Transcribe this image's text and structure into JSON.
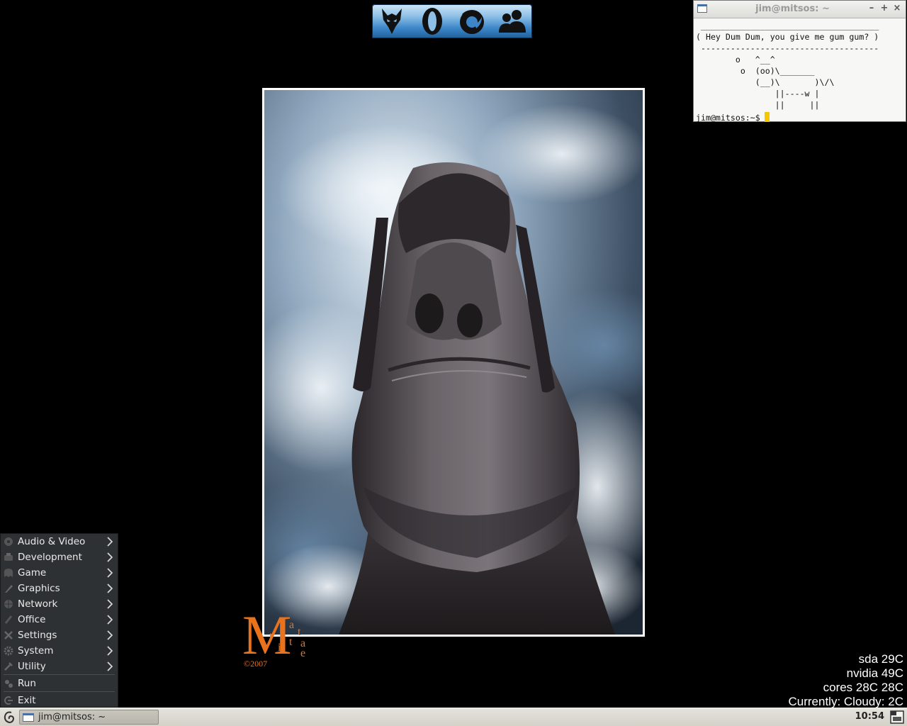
{
  "dock": {
    "items": [
      {
        "name": "launcher-wolf",
        "icon": "wolf-head-icon"
      },
      {
        "name": "launcher-opera",
        "icon": "opera-o-icon"
      },
      {
        "name": "launcher-firefox",
        "icon": "firefox-icon"
      },
      {
        "name": "launcher-messenger",
        "icon": "users-icon"
      }
    ]
  },
  "terminal": {
    "title": "jim@mitsos: ~",
    "controls": {
      "minimize": "–",
      "maximize": "+",
      "close": "×"
    },
    "lines": [
      " ____________________________________",
      "( Hey Dum Dum, you give me gum gum? )",
      " ------------------------------------",
      "        o   ^__^",
      "         o  (oo)\\_______",
      "            (__)\\       )\\/\\",
      "                ||----w |",
      "                ||     ||"
    ],
    "prompt": "jim@mitsos:~$"
  },
  "signature": {
    "letters": [
      "M",
      "a",
      "t",
      "t",
      "i",
      "t",
      "a",
      "e"
    ],
    "copyright": "©2007"
  },
  "temps": {
    "sda": "sda 29C",
    "nvidia": "nvidia 49C",
    "cores": "cores 28C 28C",
    "weather": "Currently: Cloudy: 2C"
  },
  "start_menu": {
    "categories": [
      {
        "label": "Audio & Video",
        "icon": "audio-video-icon"
      },
      {
        "label": "Development",
        "icon": "development-icon"
      },
      {
        "label": "Game",
        "icon": "game-icon"
      },
      {
        "label": "Graphics",
        "icon": "graphics-icon"
      },
      {
        "label": "Network",
        "icon": "network-icon"
      },
      {
        "label": "Office",
        "icon": "office-icon"
      },
      {
        "label": "Settings",
        "icon": "settings-icon"
      },
      {
        "label": "System",
        "icon": "system-icon"
      },
      {
        "label": "Utility",
        "icon": "utility-icon"
      }
    ],
    "run": "Run",
    "exit": "Exit"
  },
  "taskbar": {
    "task_label": "jim@mitsos: ~",
    "clock": "10:54"
  },
  "colors": {
    "desktop_bg": "#000000",
    "menu_bg": "#2e3133",
    "dock_blue": "#3d87c9",
    "signature_orange": "#e8731c",
    "cursor_yellow": "#f6c700"
  }
}
